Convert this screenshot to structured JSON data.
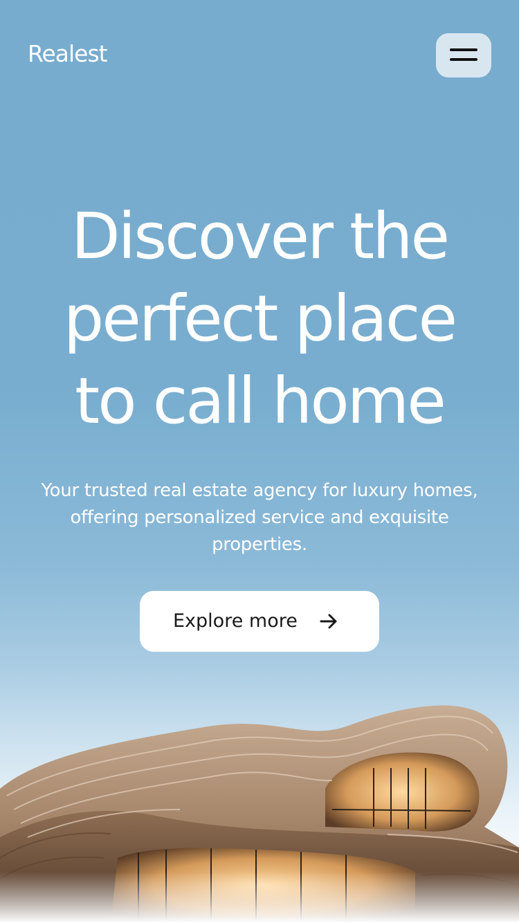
{
  "header": {
    "logo_text": "Realest",
    "menu_icon": "hamburger-menu-icon"
  },
  "hero": {
    "headline_lines": [
      "Discover the",
      "perfect place",
      "to call home"
    ],
    "subtitle_lines": [
      "Your trusted real estate agency for luxury homes,",
      "offering personalized service and exquisite",
      "properties."
    ],
    "cta_label": "Explore more",
    "cta_icon": "arrow-right-icon"
  },
  "colors": {
    "sky_blue": "#77acce",
    "text_white": "#ffffff",
    "menu_button_bg": "#d8e6f0",
    "cta_bg": "#ffffff",
    "cta_text": "#1a1a1a"
  }
}
